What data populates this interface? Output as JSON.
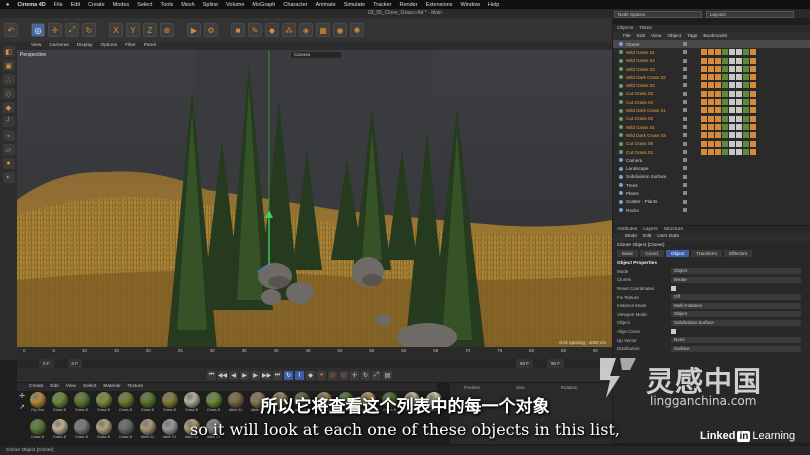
{
  "mac_menu": [
    "Cinema 4D",
    "File",
    "Edit",
    "Create",
    "Modes",
    "Select",
    "Tools",
    "Mesh",
    "Spline",
    "Volume",
    "MoGraph",
    "Character",
    "Animate",
    "Simulate",
    "Tracker",
    "Render",
    "Extensions",
    "Window",
    "Help"
  ],
  "window_title": "03_05_Clone_Grass.c4d * - Main",
  "node_spaces": "Node Spaces",
  "layouts": "Layouts",
  "viewport_menu": [
    "View",
    "Cameras",
    "Display",
    "Options",
    "Filter",
    "Panel"
  ],
  "viewport_label": "Perspective",
  "camera_dropdown": "Camera",
  "grid_spacing": "Grid Spacing : 1000 cm",
  "timeline_ticks": [
    "0",
    "5",
    "10",
    "15",
    "20",
    "25",
    "30",
    "35",
    "40",
    "45",
    "50",
    "55",
    "60",
    "65",
    "70",
    "75",
    "80",
    "85",
    "90"
  ],
  "timeline_fields": [
    "0 F",
    "0 F",
    "90 F",
    "90 F"
  ],
  "material_menu": [
    "Create",
    "Edit",
    "View",
    "Select",
    "Material",
    "Texture"
  ],
  "materials": [
    {
      "label": "Dry Gra",
      "color": "#b48a3a"
    },
    {
      "label": "Grass B",
      "color": "#6f8a3a"
    },
    {
      "label": "Grass B",
      "color": "#5d7a33"
    },
    {
      "label": "Grass B",
      "color": "#7d8f3e"
    },
    {
      "label": "Grass B",
      "color": "#6a7f30"
    },
    {
      "label": "Grass B",
      "color": "#5b7730"
    },
    {
      "label": "Grass B",
      "color": "#8a7c3a"
    },
    {
      "label": "Grass B",
      "color": "#b9b09a"
    },
    {
      "label": "Grass B",
      "color": "#6b8a38"
    },
    {
      "label": "dArth 01",
      "color": "#7a6a45"
    },
    {
      "label": "dArth 01",
      "color": "#8a7a55"
    },
    {
      "label": "dArth 01",
      "color": "#9a8a60"
    },
    {
      "label": "dArth 01",
      "color": "#6d6040"
    },
    {
      "label": "dArth 01",
      "color": "#a08e5f"
    },
    {
      "label": "Dry Gra",
      "color": "#4f7a2f"
    },
    {
      "label": "Grass B",
      "color": "#b79a62"
    },
    {
      "label": "Grass B",
      "color": "#4d6e2c"
    },
    {
      "label": "Grass B",
      "color": "#c7b89a"
    },
    {
      "label": "Grass B",
      "color": "#d3c7ad"
    },
    {
      "label": "Grass B",
      "color": "#5a7d32"
    },
    {
      "label": "Grass B",
      "color": "#c0b090"
    },
    {
      "label": "Grass B",
      "color": "#7b7b7b"
    },
    {
      "label": "Grass B",
      "color": "#b3a27c"
    },
    {
      "label": "Grass B",
      "color": "#6a6a6a"
    },
    {
      "label": "dArth 01",
      "color": "#a89878"
    },
    {
      "label": "dArth 01",
      "color": "#9a9a9a"
    },
    {
      "label": "dArth 01",
      "color": "#b0a07a"
    },
    {
      "label": "dArth 01",
      "color": "#8c8c8c"
    }
  ],
  "coords_headers": [
    "Position",
    "Size",
    "Rotation"
  ],
  "status_text": "Cloner Object [Cloner]",
  "object_tabs": [
    "Objects",
    "Takes"
  ],
  "object_menu": [
    "File",
    "Edit",
    "View",
    "Object",
    "Tags",
    "Bookmarks"
  ],
  "objects": [
    {
      "name": "Cloner",
      "selected": false,
      "top": true
    },
    {
      "name": "Wild Grass 01",
      "selected": true
    },
    {
      "name": "Wild Grass 04",
      "selected": true
    },
    {
      "name": "Wild Grass 03",
      "selected": true
    },
    {
      "name": "Wild Dark Grass 02",
      "selected": true
    },
    {
      "name": "Wild Grass 02",
      "selected": true
    },
    {
      "name": "Cut Grass 03",
      "selected": true
    },
    {
      "name": "Cut Grass 04",
      "selected": true
    },
    {
      "name": "Wild Dark Grass 01",
      "selected": true
    },
    {
      "name": "Cut Grass 02",
      "selected": true
    },
    {
      "name": "Wild Grass 01",
      "selected": true
    },
    {
      "name": "Wild Dark Grass 03",
      "selected": true
    },
    {
      "name": "Cut Grass 05",
      "selected": true
    },
    {
      "name": "Cut Grass 01",
      "selected": true
    },
    {
      "name": "Camera",
      "selected": false
    },
    {
      "name": "Landscape",
      "selected": false
    },
    {
      "name": "Subdivision Surface",
      "selected": false
    },
    {
      "name": "Trees",
      "selected": false
    },
    {
      "name": "Plants",
      "selected": false
    },
    {
      "name": "Scatter - Plants",
      "selected": false
    },
    {
      "name": "Rocks",
      "selected": false
    }
  ],
  "attr_tabs": [
    "Attributes",
    "Layers",
    "Structure"
  ],
  "attr_menu": [
    "Mode",
    "Edit",
    "User Data"
  ],
  "attr_title": "Cloner Object [Cloner]",
  "attr_subtabs": [
    "Basic",
    "Coord.",
    "Object",
    "Transform",
    "Effectors"
  ],
  "attr_section": "Object Properties",
  "attributes": [
    {
      "label": "Mode",
      "value": "Object",
      "type": "dd"
    },
    {
      "label": "Clones",
      "value": "Iterate",
      "type": "dd"
    },
    {
      "label": "Reset Coordinates",
      "value": "",
      "type": "chk"
    },
    {
      "label": "Fix Texture",
      "value": "Off",
      "type": "dd"
    },
    {
      "label": "Instance Mode",
      "value": "Multi-Instance",
      "type": "dd"
    },
    {
      "label": "Viewport Mode",
      "value": "Object",
      "type": "dd"
    },
    {
      "label": "Object",
      "value": "Subdivision Surface",
      "type": "dd"
    },
    {
      "label": "Align Clone",
      "value": "",
      "type": "chk"
    },
    {
      "label": "Up Vector",
      "value": "None",
      "type": "dd"
    },
    {
      "label": "Distribution",
      "value": "Surface",
      "type": "dd"
    }
  ],
  "subtitle_cn": "所以它将查看这个列表中的每一个对象",
  "subtitle_en": "so it will look at each one of these objects in this list,",
  "watermark_cn": "灵感中国",
  "watermark_url": "lingganchina.com",
  "linkedin_a": "Linked",
  "linkedin_b": "in",
  "linkedin_c": "Learning"
}
